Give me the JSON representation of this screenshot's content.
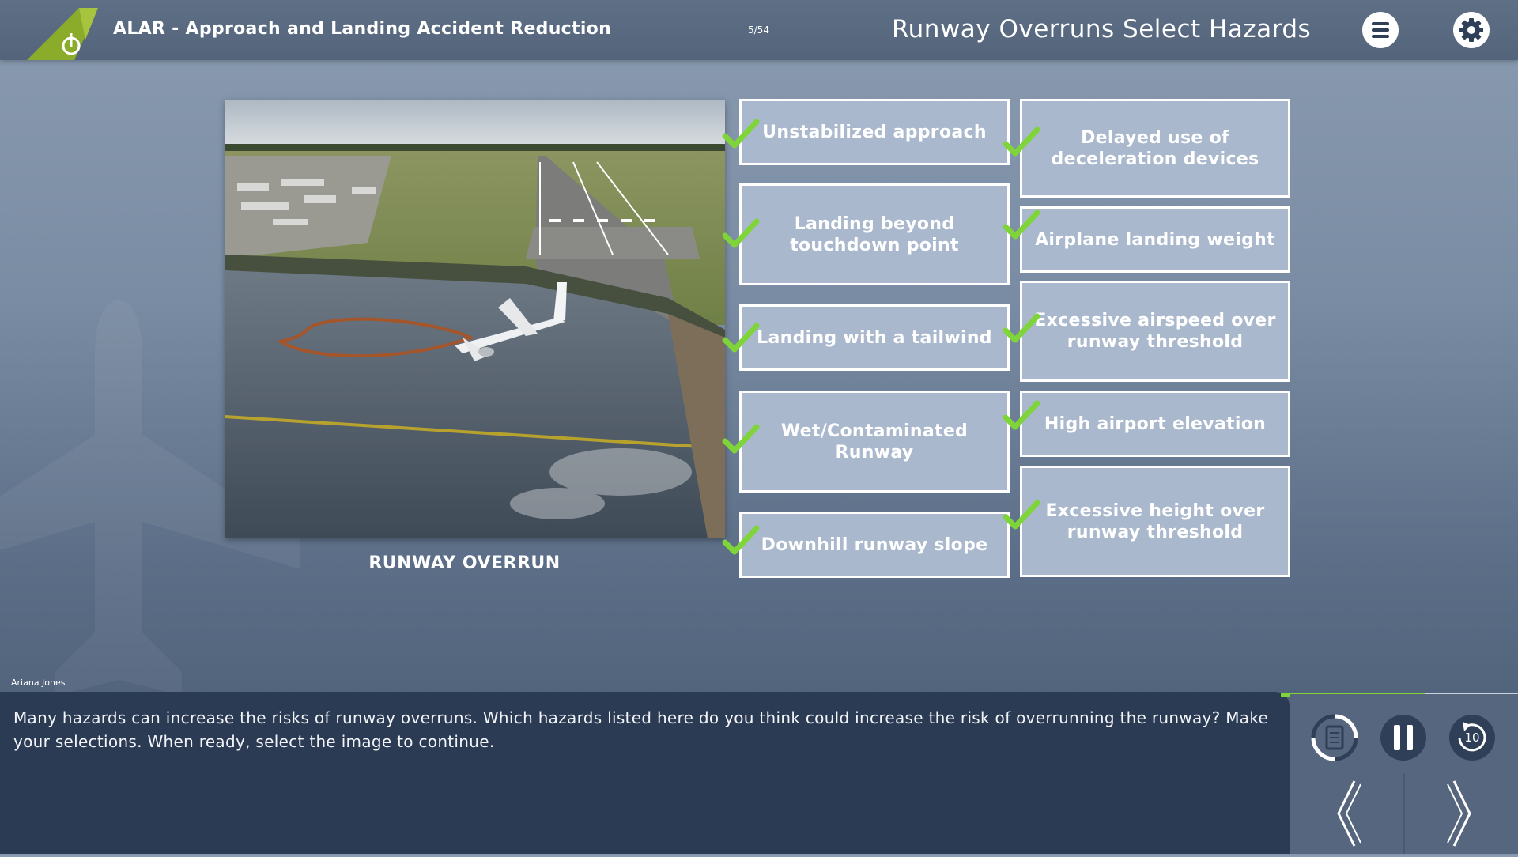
{
  "header": {
    "app_title": "ALAR - Approach and Landing Accident Reduction",
    "page_counter": "5/54",
    "screen_title": "Runway Overruns Select Hazards",
    "menu_icon": "hamburger-menu-icon",
    "settings_icon": "gear-icon"
  },
  "scene": {
    "caption": "RUNWAY OVERRUN"
  },
  "hazards": {
    "left": [
      {
        "label": "Unstabilized approach",
        "checked": true
      },
      {
        "label": "Landing beyond touchdown point",
        "checked": true
      },
      {
        "label": "Landing with a tailwind",
        "checked": true
      },
      {
        "label": "Wet/Contaminated Runway",
        "checked": true
      },
      {
        "label": "Downhill runway slope",
        "checked": true
      }
    ],
    "right": [
      {
        "label": "Delayed use of deceleration devices",
        "checked": true
      },
      {
        "label": "Airplane landing weight",
        "checked": true
      },
      {
        "label": "Excessive airspeed over runway threshold",
        "checked": true
      },
      {
        "label": "High airport elevation",
        "checked": true
      },
      {
        "label": "Excessive height over runway threshold",
        "checked": true
      }
    ]
  },
  "narrator": "Ariana Jones",
  "narration": "Many hazards can increase the risks of runway overruns. Which hazards listed here do you think could increase the risk of overrunning the runway? Make your selections. When ready, select the image to continue.",
  "controls": {
    "progress": 0.61,
    "accent": "#7fd43a",
    "transcript_icon": "transcript-refresh-icon",
    "pause_icon": "pause-icon",
    "replay_icon": "replay-10-icon",
    "replay_label": "10",
    "prev_icon": "chevron-left-icon",
    "next_icon": "chevron-right-icon"
  }
}
